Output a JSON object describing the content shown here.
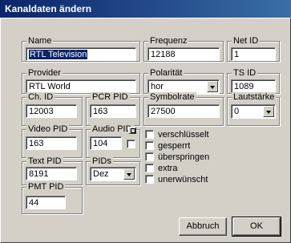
{
  "window": {
    "title": "Kanaldaten ändern"
  },
  "fields": {
    "name": {
      "label": "Name",
      "value": "RTL Television"
    },
    "frequenz": {
      "label": "Frequenz",
      "value": "12188"
    },
    "net_id": {
      "label": "Net ID",
      "value": "1"
    },
    "provider": {
      "label": "Provider",
      "value": "RTL World"
    },
    "polaritaet": {
      "label": "Polarität",
      "value": "hor"
    },
    "ts_id": {
      "label": "TS ID",
      "value": "1089"
    },
    "ch_id": {
      "label": "Ch. ID",
      "value": "12003"
    },
    "pcr_pid": {
      "label": "PCR PID",
      "value": "163"
    },
    "symbolrate": {
      "label": "Symbolrate",
      "value": "27500"
    },
    "lautstaerke": {
      "label": "Lautstärke",
      "value": "0"
    },
    "video_pid": {
      "label": "Video PID",
      "value": "163"
    },
    "audio_pid": {
      "label": "Audio PID",
      "value": "104"
    },
    "text_pid": {
      "label": "Text PID",
      "value": "8191"
    },
    "pids": {
      "label": "PIDs",
      "value": "Dez"
    },
    "pmt_pid": {
      "label": "PMT PID",
      "value": "44"
    }
  },
  "checkboxes": [
    {
      "label": "verschlüsselt",
      "checked": false
    },
    {
      "label": "gesperrt",
      "checked": false
    },
    {
      "label": "überspringen",
      "checked": false
    },
    {
      "label": "extra",
      "checked": false
    },
    {
      "label": "unerwünscht",
      "checked": false
    }
  ],
  "buttons": {
    "cancel": "Abbruch",
    "ok": "OK"
  }
}
